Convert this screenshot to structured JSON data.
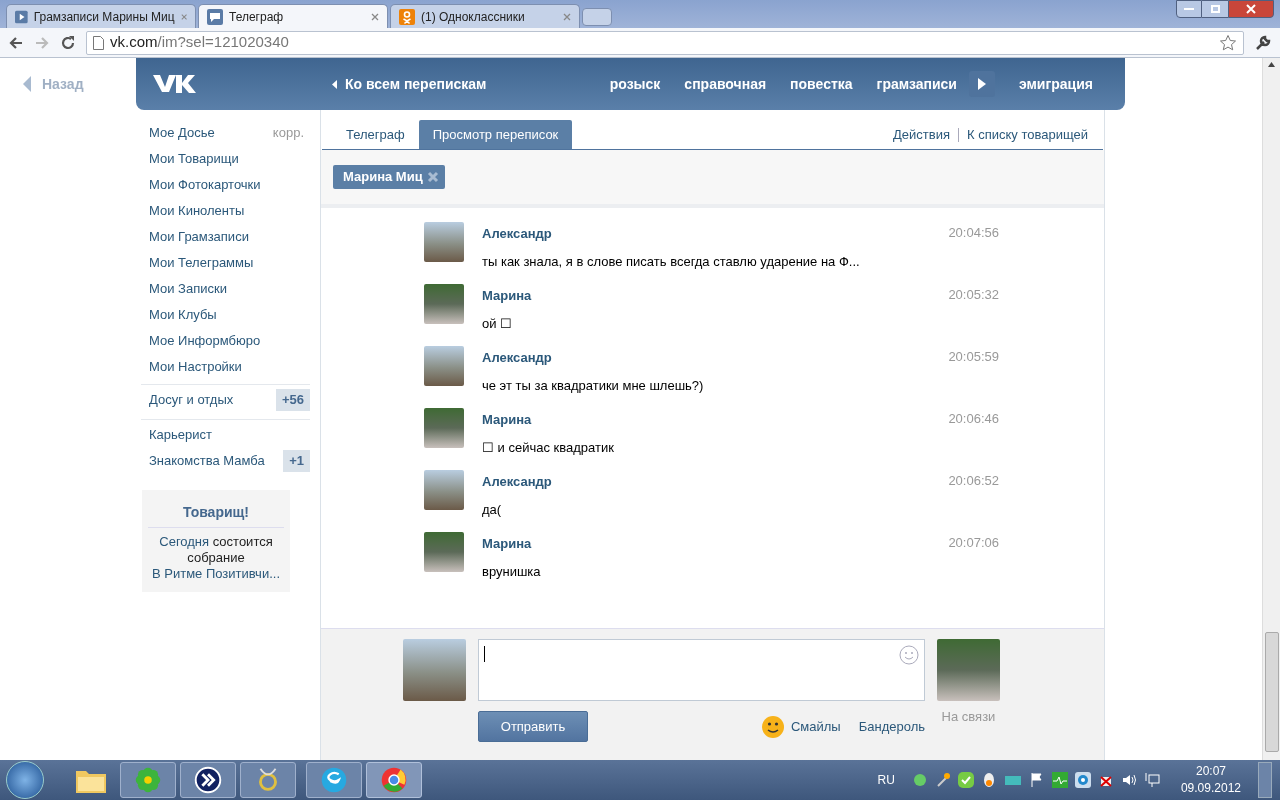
{
  "browser": {
    "tabs": [
      {
        "title": "Грамзаписи Марины Миц",
        "selected": false,
        "kind": "play"
      },
      {
        "title": "Телеграф",
        "selected": true,
        "kind": "chat"
      },
      {
        "title": "(1) Одноклассники",
        "selected": false,
        "kind": "ok"
      }
    ],
    "url": {
      "host": "vk.com",
      "path": "/im?sel=121020340"
    }
  },
  "header": {
    "back": "Назад",
    "to_all": "Ко всем перепискам",
    "nav": [
      "розыск",
      "справочная",
      "повестка",
      "грамзаписи",
      "эмиграция"
    ]
  },
  "sidebar": {
    "menu": [
      {
        "label": "Мое Досье",
        "extra": "корр."
      },
      {
        "label": "Мои Товарищи"
      },
      {
        "label": "Мои Фотокарточки"
      },
      {
        "label": "Мои Киноленты"
      },
      {
        "label": "Мои Грамзаписи"
      },
      {
        "label": "Мои Телеграммы"
      },
      {
        "label": "Мои Записки"
      },
      {
        "label": "Мои Клубы"
      },
      {
        "label": "Мое Информбюро"
      },
      {
        "label": "Мои Настройки"
      }
    ],
    "groups": [
      {
        "label": "Досуг и отдых",
        "badge": "+56"
      }
    ],
    "apps": [
      {
        "label": "Карьерист"
      },
      {
        "label": "Знакомства Мамба",
        "badge": "+1"
      }
    ],
    "notice": {
      "title": "Товарищ!",
      "parts": [
        {
          "text": "Сегодня",
          "link": true
        },
        {
          "text": " состоится собрание ",
          "link": false
        },
        {
          "text": "В Ритме Позитивчи...",
          "link": true
        }
      ]
    }
  },
  "main": {
    "tabs": [
      {
        "label": "Телеграф",
        "selected": false
      },
      {
        "label": "Просмотр переписок",
        "selected": true
      }
    ],
    "actions": [
      "Действия",
      "К списку товарищей"
    ],
    "chip": "Марина Миц",
    "messages": [
      {
        "author": "Александр",
        "text": "ты как знала, я в слове писать всегда ставлю ударение на Ф...",
        "time": "20:04:56",
        "kind": "him"
      },
      {
        "author": "Марина",
        "text": "ой ☐",
        "time": "20:05:32",
        "kind": "her"
      },
      {
        "author": "Александр",
        "text": "че эт ты за квадратики мне шлешь?)",
        "time": "20:05:59",
        "kind": "him"
      },
      {
        "author": "Марина",
        "text": "☐ и сейчас квадратик",
        "time": "20:06:46",
        "kind": "her"
      },
      {
        "author": "Александр",
        "text": "да(",
        "time": "20:06:52",
        "kind": "him"
      },
      {
        "author": "Марина",
        "text": "врунишка",
        "time": "20:07:06",
        "kind": "her"
      }
    ],
    "composer": {
      "send": "Отправить",
      "smiles": "Смайлы",
      "parcel": "Бандероль",
      "status": "На связи"
    }
  },
  "taskbar": {
    "lang": "RU",
    "time": "20:07",
    "date": "09.09.2012"
  }
}
